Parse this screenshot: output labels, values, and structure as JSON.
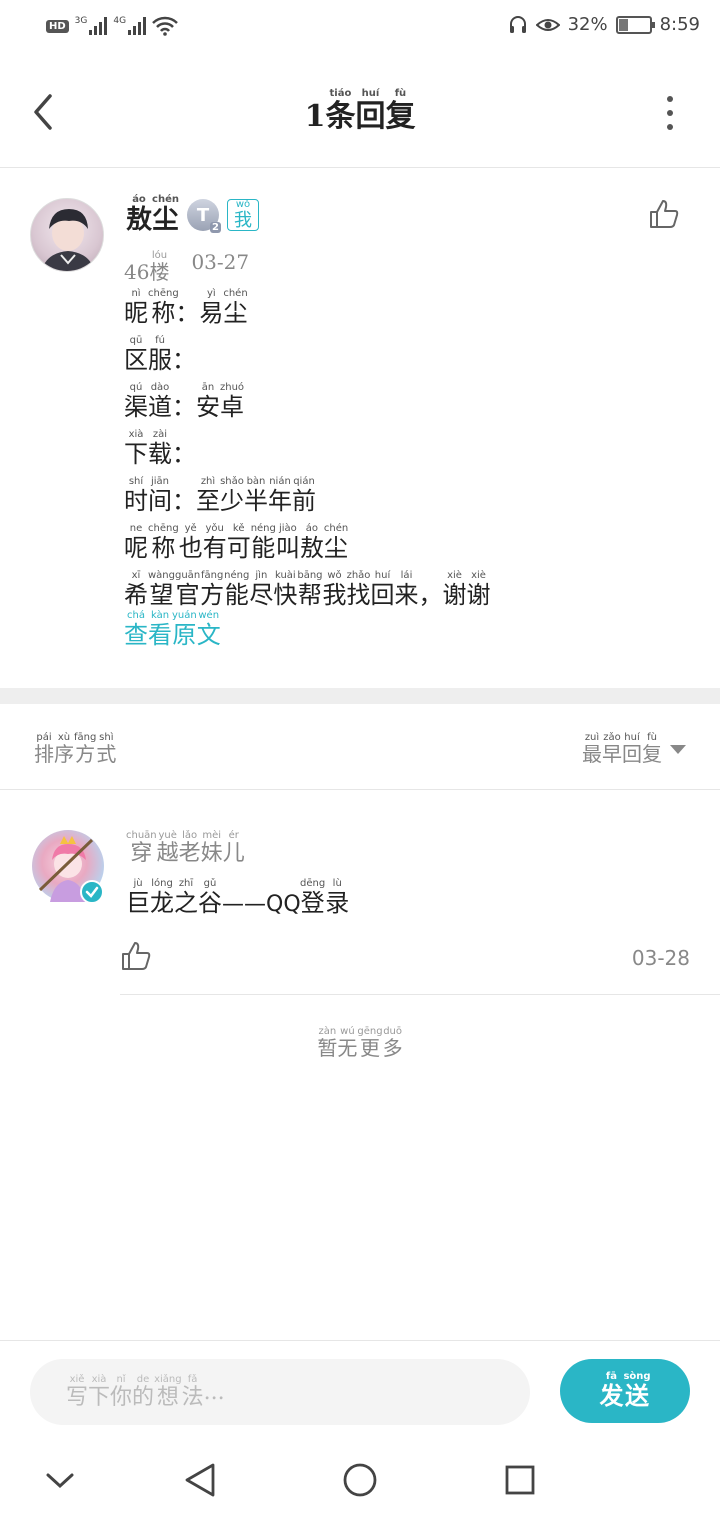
{
  "status_bar": {
    "hd": "HD",
    "net1": "3G",
    "net2": "4G",
    "battery_text": "32%",
    "battery_level": 0.32,
    "time": "8:59"
  },
  "header": {
    "title_prefix": "1",
    "title_chars": [
      {
        "c": "条",
        "py": "tiáo"
      },
      {
        "c": "回",
        "py": "huí"
      },
      {
        "c": "复",
        "py": "fù"
      }
    ]
  },
  "post": {
    "name_chars": [
      {
        "c": "敖",
        "py": "áo"
      },
      {
        "c": "尘",
        "py": "chén"
      }
    ],
    "level": "T",
    "level_sub": "2",
    "me_badge": {
      "c": "我",
      "py": "wǒ"
    },
    "floor_num": "46",
    "floor_char": {
      "c": "楼",
      "py": "lóu"
    },
    "date": "03-27",
    "lines": [
      [
        {
          "c": "昵",
          "py": "nì"
        },
        {
          "c": "称",
          "py": "chēng"
        },
        {
          "c": "：",
          "py": ""
        },
        {
          "c": "易",
          "py": "yì"
        },
        {
          "c": "尘",
          "py": "chén"
        }
      ],
      [
        {
          "c": "区",
          "py": "qū"
        },
        {
          "c": "服",
          "py": "fú"
        },
        {
          "c": "：",
          "py": ""
        }
      ],
      [
        {
          "c": "渠",
          "py": "qú"
        },
        {
          "c": "道",
          "py": "dào"
        },
        {
          "c": "：",
          "py": ""
        },
        {
          "c": "安",
          "py": "ān"
        },
        {
          "c": "卓",
          "py": "zhuó"
        }
      ],
      [
        {
          "c": "下",
          "py": "xià"
        },
        {
          "c": "载",
          "py": "zài"
        },
        {
          "c": "：",
          "py": ""
        }
      ],
      [
        {
          "c": "时",
          "py": "shí"
        },
        {
          "c": "间",
          "py": "jiān"
        },
        {
          "c": "：",
          "py": ""
        },
        {
          "c": "至",
          "py": "zhì"
        },
        {
          "c": "少",
          "py": "shǎo"
        },
        {
          "c": "半",
          "py": "bàn"
        },
        {
          "c": "年",
          "py": "nián"
        },
        {
          "c": "前",
          "py": "qián"
        }
      ],
      [
        {
          "c": "呢",
          "py": "ne"
        },
        {
          "c": "称",
          "py": "chēng"
        },
        {
          "c": "也",
          "py": "yě"
        },
        {
          "c": "有",
          "py": "yǒu"
        },
        {
          "c": "可",
          "py": "kě"
        },
        {
          "c": "能",
          "py": "néng"
        },
        {
          "c": "叫",
          "py": "jiào"
        },
        {
          "c": "敖",
          "py": "áo"
        },
        {
          "c": "尘",
          "py": "chén"
        }
      ],
      [
        {
          "c": "希",
          "py": "xī"
        },
        {
          "c": "望",
          "py": "wàng"
        },
        {
          "c": "官",
          "py": "guān"
        },
        {
          "c": "方",
          "py": "fāng"
        },
        {
          "c": "能",
          "py": "néng"
        },
        {
          "c": "尽",
          "py": "jìn"
        },
        {
          "c": "快",
          "py": "kuài"
        },
        {
          "c": "帮",
          "py": "bāng"
        },
        {
          "c": "我",
          "py": "wǒ"
        },
        {
          "c": "找",
          "py": "zhǎo"
        },
        {
          "c": "回",
          "py": "huí"
        },
        {
          "c": "来",
          "py": "lái"
        },
        {
          "c": "，",
          "py": ""
        },
        {
          "c": "谢",
          "py": "xiè"
        },
        {
          "c": "谢",
          "py": "xiè"
        }
      ]
    ],
    "view_original": [
      {
        "c": "查",
        "py": "chá"
      },
      {
        "c": "看",
        "py": "kàn"
      },
      {
        "c": "原",
        "py": "yuán"
      },
      {
        "c": "文",
        "py": "wén"
      }
    ]
  },
  "sort": {
    "label": [
      {
        "c": "排",
        "py": "pái"
      },
      {
        "c": "序",
        "py": "xù"
      },
      {
        "c": "方",
        "py": "fāng"
      },
      {
        "c": "式",
        "py": "shì"
      }
    ],
    "selected": [
      {
        "c": "最",
        "py": "zuì"
      },
      {
        "c": "早",
        "py": "zǎo"
      },
      {
        "c": "回",
        "py": "huí"
      },
      {
        "c": "复",
        "py": "fù"
      }
    ]
  },
  "reply": {
    "name": [
      {
        "c": "穿",
        "py": "chuān"
      },
      {
        "c": "越",
        "py": "yuè"
      },
      {
        "c": "老",
        "py": "lǎo"
      },
      {
        "c": "妹",
        "py": "mèi"
      },
      {
        "c": "儿",
        "py": "ér"
      }
    ],
    "text_chars": [
      {
        "c": "巨",
        "py": "jù"
      },
      {
        "c": "龙",
        "py": "lóng"
      },
      {
        "c": "之",
        "py": "zhī"
      },
      {
        "c": "谷",
        "py": "gǔ"
      }
    ],
    "text_mid": "——QQ",
    "text_end": [
      {
        "c": "登",
        "py": "dēng"
      },
      {
        "c": "录",
        "py": "lù"
      }
    ],
    "date": "03-28"
  },
  "no_more": [
    {
      "c": "暂",
      "py": "zàn"
    },
    {
      "c": "无",
      "py": "wú"
    },
    {
      "c": "更",
      "py": "gēng"
    },
    {
      "c": "多",
      "py": "duō"
    }
  ],
  "input": {
    "placeholder": [
      {
        "c": "写",
        "py": "xiě"
      },
      {
        "c": "下",
        "py": "xià"
      },
      {
        "c": "你",
        "py": "nǐ"
      },
      {
        "c": "的",
        "py": "de"
      },
      {
        "c": "想",
        "py": "xiǎng"
      },
      {
        "c": "法",
        "py": "fǎ"
      }
    ],
    "placeholder_tail": "...",
    "send": [
      {
        "c": "发",
        "py": "fā"
      },
      {
        "c": "送",
        "py": "sòng"
      }
    ]
  },
  "colors": {
    "accent": "#2ab6c6",
    "divider": "#e6e6e6",
    "muted": "#888888"
  },
  "icons": [
    "back-arrow-icon",
    "more-vertical-icon",
    "thumbs-up-icon",
    "verified-check-icon",
    "chevron-down-icon",
    "triangle-back-icon",
    "circle-home-icon",
    "square-recents-icon"
  ]
}
